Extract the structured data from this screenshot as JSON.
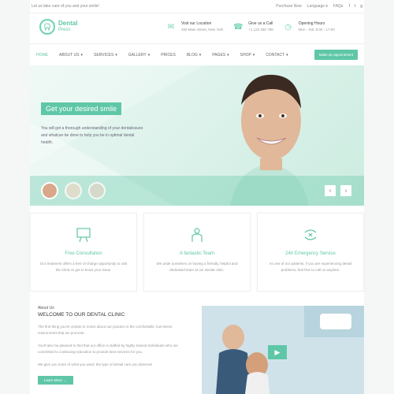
{
  "topbar": {
    "tagline": "Let us take care of you and your smile!",
    "links": [
      "Purchase Now",
      "Language",
      "FAQs"
    ],
    "social_icons": [
      "facebook-icon",
      "twitter-icon",
      "google-plus-icon"
    ]
  },
  "logo": {
    "line1": "Dental",
    "line2": "Press"
  },
  "header_info": [
    {
      "icon": "envelope-icon",
      "title": "Visit our Location",
      "sub": "250 Main Street, New York"
    },
    {
      "icon": "phone-icon",
      "title": "Give us a Call",
      "sub": "+1 123 456 789"
    },
    {
      "icon": "clock-icon",
      "title": "Opening Hours",
      "sub": "Mon - Sat: 8:00 - 17:00"
    }
  ],
  "nav": {
    "items": [
      "HOME",
      "ABOUT US",
      "SERVICES",
      "GALLERY",
      "PRICES",
      "BLOG",
      "PAGES",
      "SHOP",
      "CONTACT"
    ],
    "button": "Make an appointment"
  },
  "hero": {
    "title": "Get your desired smile",
    "text": "You will get a thorough understanding of your dentalissues and whatcan be done to help you be in optimal dental health.",
    "prev": "‹",
    "next": "›"
  },
  "features": [
    {
      "icon": "consultation-icon",
      "title": "Free Consultation",
      "text": "Our treatment offers a free of charge opportunity to visit the Clinic to get to know your issue."
    },
    {
      "icon": "team-icon",
      "title": "A fantastic Team",
      "text": "We pride ourselves on having a friendly, helpful and dedicated team at our dental clinic."
    },
    {
      "icon": "emergency-icon",
      "title": "24h Emergency Service",
      "text": "As one of our patients, if you are experiencing dental problems, feel free to call us anytime."
    }
  ],
  "about": {
    "kicker": "About Us",
    "title": "WELCOME TO OUR DENTAL CLINIC",
    "p1": "The first thing you're certain to notice about our practice is the comfortable, low-stress environment that we promote.",
    "p2": "You'll also be pleased to find that our office is staffed by highly trained individuals who are committed to continuing education to provide best services for you.",
    "p3": "We give you more of what you want: the type of dental care you deserve!",
    "button": "Learn More"
  },
  "colors": {
    "accent": "#5fc7a7"
  }
}
